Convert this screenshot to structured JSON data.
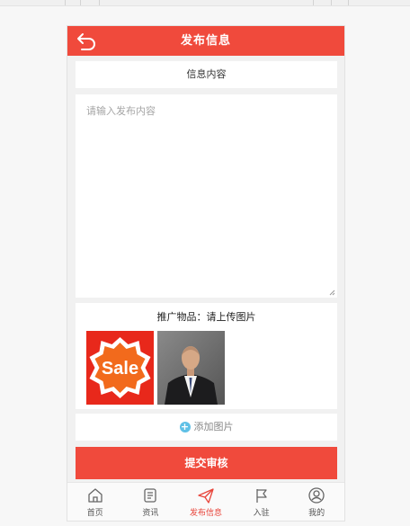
{
  "header": {
    "title": "发布信息",
    "back_icon": "back-arrow-icon"
  },
  "section": {
    "title": "信息内容"
  },
  "content": {
    "placeholder": "请输入发布内容",
    "value": ""
  },
  "promo": {
    "label": "推广物品：请上传图片",
    "images": [
      {
        "name": "sale-badge-image",
        "text": "Sale"
      },
      {
        "name": "portrait-photo"
      }
    ]
  },
  "add_image": {
    "label": "添加图片",
    "icon": "plus-circle-icon"
  },
  "submit": {
    "label": "提交审核"
  },
  "tabs": [
    {
      "label": "首页",
      "icon": "home-icon",
      "active": false
    },
    {
      "label": "资讯",
      "icon": "news-icon",
      "active": false
    },
    {
      "label": "发布信息",
      "icon": "send-icon",
      "active": true
    },
    {
      "label": "入驻",
      "icon": "flag-icon",
      "active": false
    },
    {
      "label": "我的",
      "icon": "user-icon",
      "active": false
    }
  ],
  "colors": {
    "accent": "#f04a3c",
    "active_tab": "#e8443a",
    "plus": "#5fc0e6"
  }
}
